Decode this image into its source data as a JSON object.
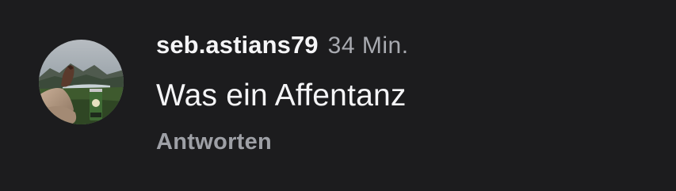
{
  "comment": {
    "username": "seb.astians79",
    "timestamp": "34 Min.",
    "text": "Was ein Affentanz",
    "reply_label": "Antworten",
    "avatar": {
      "description_icon": "avatar-photo",
      "colors": {
        "sky": "#8e9aa3",
        "mountain": "#4f5a4e",
        "lake": "#c9d2d6",
        "grass": "#3e5a2e",
        "legs": "#b79c85",
        "shoe": "#5a3a2c",
        "can": "#3f6b34"
      }
    }
  },
  "theme": {
    "background": "#1c1c1e",
    "primary_text": "#f5f5f7",
    "secondary_text": "#a8aab0",
    "action_text": "#9ea0a6"
  }
}
